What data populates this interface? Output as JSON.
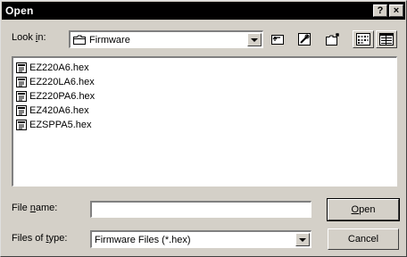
{
  "window": {
    "title": "Open",
    "help_label": "?",
    "close_label": "×"
  },
  "lookin": {
    "label_pre": "Look ",
    "label_acc": "i",
    "label_post": "n:",
    "value": "Firmware"
  },
  "toolbar": {
    "buttons": [
      {
        "name": "up-folder-button",
        "icon": "up-folder-icon"
      },
      {
        "name": "desktop-button",
        "icon": "desktop-icon"
      },
      {
        "name": "new-folder-button",
        "icon": "new-folder-icon"
      },
      {
        "name": "list-view-button",
        "icon": "list-view-icon"
      },
      {
        "name": "details-view-button",
        "icon": "details-view-icon"
      }
    ]
  },
  "files": [
    {
      "name": "EZ220A6.hex"
    },
    {
      "name": "EZ220LA6.hex"
    },
    {
      "name": "EZ220PA6.hex"
    },
    {
      "name": "EZ420A6.hex"
    },
    {
      "name": "EZSPPA5.hex"
    }
  ],
  "filename": {
    "label_pre": "File ",
    "label_acc": "n",
    "label_post": "ame:",
    "value": ""
  },
  "filetype": {
    "label_pre": "Files of ",
    "label_acc": "t",
    "label_post": "ype:",
    "value": "Firmware Files (*.hex)"
  },
  "buttons": {
    "open_acc": "O",
    "open_rest": "pen",
    "cancel": "Cancel"
  }
}
